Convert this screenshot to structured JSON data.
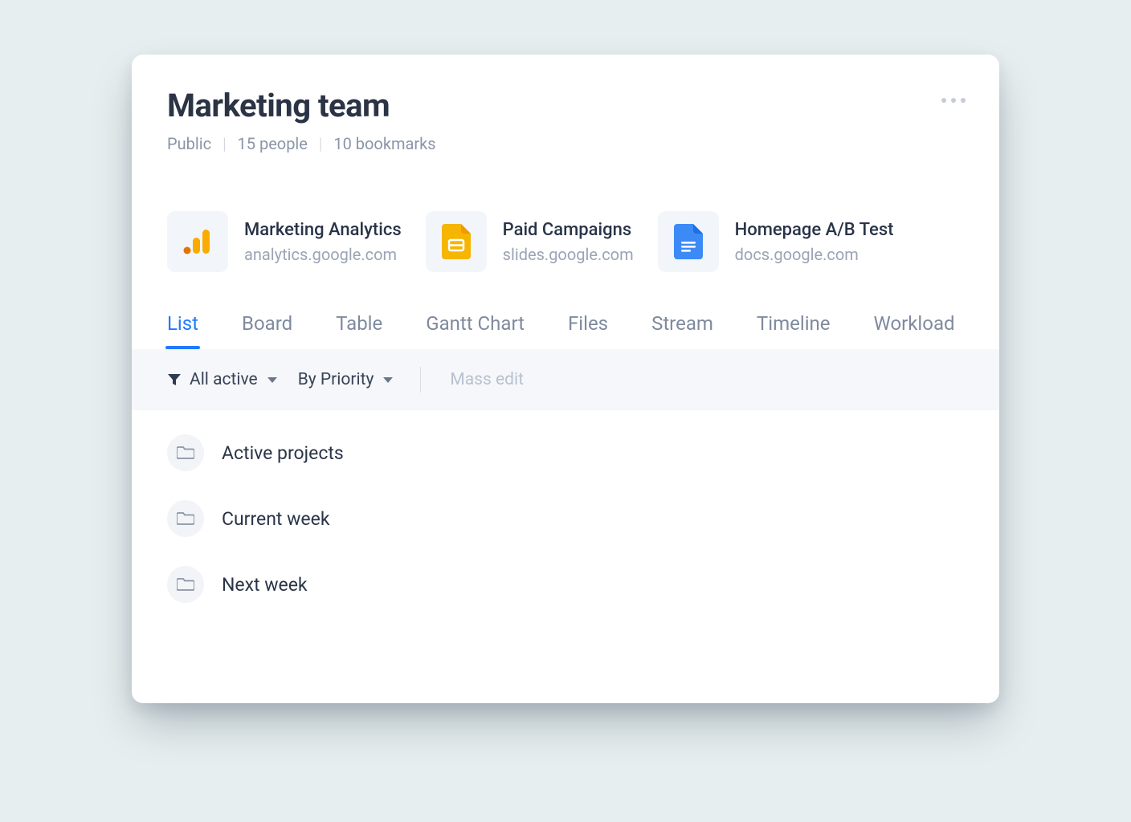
{
  "header": {
    "title": "Marketing team",
    "visibility": "Public",
    "people": "15 people",
    "bookmarks_count": "10 bookmarks"
  },
  "bookmarks": [
    {
      "label": "Marketing Analytics",
      "url": "analytics.google.com",
      "icon": "analytics"
    },
    {
      "label": "Paid Campaigns",
      "url": "slides.google.com",
      "icon": "slides"
    },
    {
      "label": "Homepage A/B Test",
      "url": "docs.google.com",
      "icon": "docs"
    }
  ],
  "tabs": [
    "List",
    "Board",
    "Table",
    "Gantt Chart",
    "Files",
    "Stream",
    "Timeline",
    "Workload"
  ],
  "active_tab_index": 0,
  "filterbar": {
    "status": "All active",
    "sort": "By Priority",
    "mass_edit": "Mass edit"
  },
  "folders": [
    "Active projects",
    "Current week",
    "Next week"
  ]
}
